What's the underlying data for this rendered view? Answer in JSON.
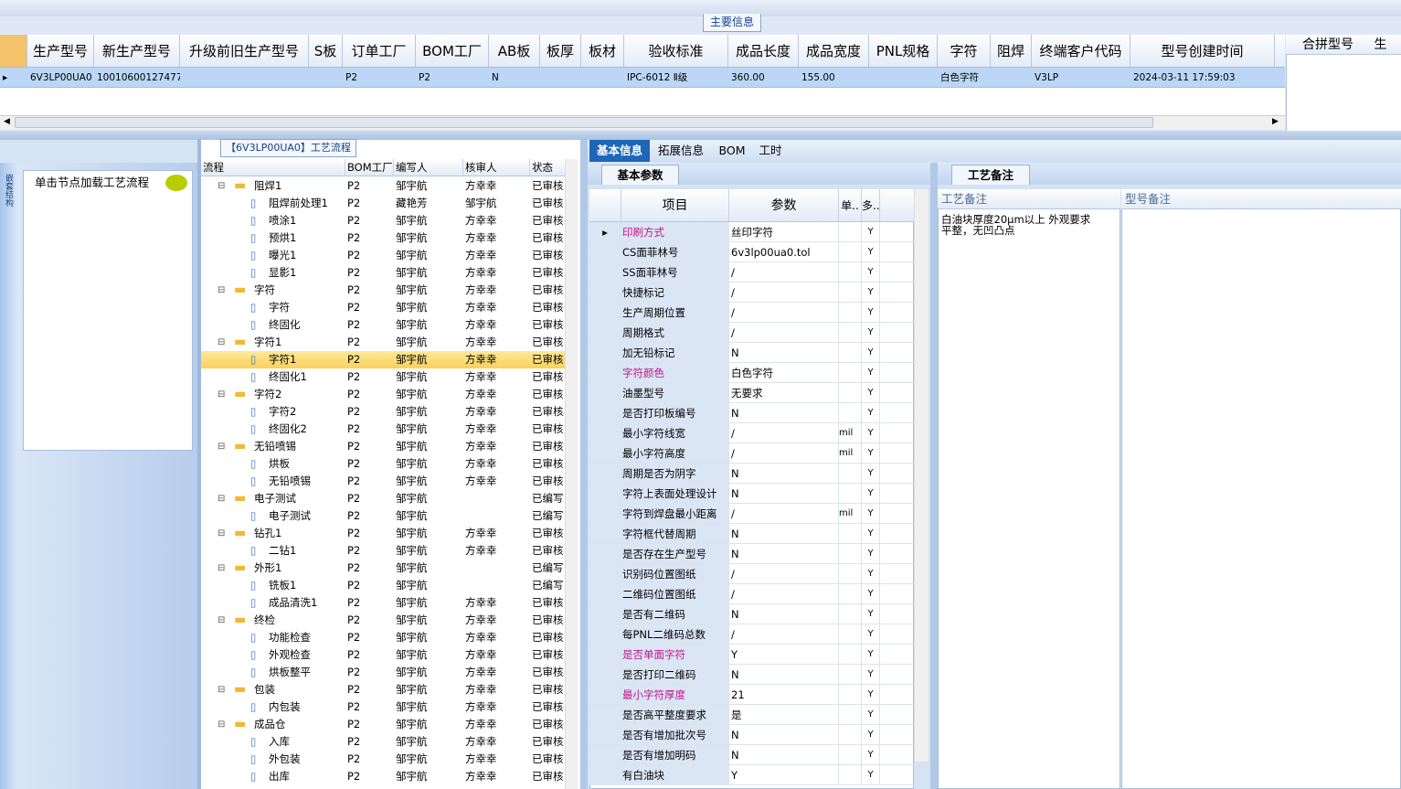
{
  "top": {
    "section_title": "主要信息",
    "columns": [
      "生产型号",
      "新生产型号",
      "升级前旧生产型号",
      "S板",
      "订单工厂",
      "BOM工厂",
      "AB板",
      "板厚",
      "板材",
      "验收标准",
      "成品长度",
      "成品宽度",
      "PNL规格",
      "字符",
      "阻焊",
      "终端客户代码",
      "型号创建时间"
    ],
    "row": [
      "6V3LP00UA0",
      "10010600127477",
      "",
      "",
      "P2",
      "P2",
      "N",
      "",
      "",
      "IPC-6012 Ⅱ级",
      "360.00",
      "155.00",
      "",
      "白色字符",
      "",
      "V3LP",
      "2024-03-11 17:59:03"
    ],
    "right_header": "合拼型号",
    "right_header2": "生"
  },
  "left_nav": {
    "vertical_tab": "嵌套结构",
    "title": "单击节点加载工艺流程"
  },
  "flow": {
    "title": "【6V3LP00UA0】工艺流程",
    "headers": [
      "流程",
      "BOM工厂",
      "编写人",
      "核审人",
      "状态"
    ],
    "rows": [
      {
        "lvl": 1,
        "name": "阻焊1",
        "bom": "P2",
        "writer": "邹宇航",
        "reviewer": "方幸幸",
        "status": "已审核"
      },
      {
        "lvl": 2,
        "name": "阻焊前处理1",
        "bom": "P2",
        "writer": "藏艳芳",
        "reviewer": "邹宇航",
        "status": "已审核"
      },
      {
        "lvl": 2,
        "name": "喷涂1",
        "bom": "P2",
        "writer": "邹宇航",
        "reviewer": "方幸幸",
        "status": "已审核"
      },
      {
        "lvl": 2,
        "name": "预烘1",
        "bom": "P2",
        "writer": "邹宇航",
        "reviewer": "方幸幸",
        "status": "已审核"
      },
      {
        "lvl": 2,
        "name": "曝光1",
        "bom": "P2",
        "writer": "邹宇航",
        "reviewer": "方幸幸",
        "status": "已审核"
      },
      {
        "lvl": 2,
        "name": "显影1",
        "bom": "P2",
        "writer": "邹宇航",
        "reviewer": "方幸幸",
        "status": "已审核"
      },
      {
        "lvl": 1,
        "name": "字符",
        "bom": "P2",
        "writer": "邹宇航",
        "reviewer": "方幸幸",
        "status": "已审核"
      },
      {
        "lvl": 2,
        "name": "字符",
        "bom": "P2",
        "writer": "邹宇航",
        "reviewer": "方幸幸",
        "status": "已审核"
      },
      {
        "lvl": 2,
        "name": "终固化",
        "bom": "P2",
        "writer": "邹宇航",
        "reviewer": "方幸幸",
        "status": "已审核"
      },
      {
        "lvl": 1,
        "name": "字符1",
        "bom": "P2",
        "writer": "邹宇航",
        "reviewer": "方幸幸",
        "status": "已审核"
      },
      {
        "lvl": 2,
        "name": "字符1",
        "bom": "P2",
        "writer": "邹宇航",
        "reviewer": "方幸幸",
        "status": "已审核",
        "selected": true
      },
      {
        "lvl": 2,
        "name": "终固化1",
        "bom": "P2",
        "writer": "邹宇航",
        "reviewer": "方幸幸",
        "status": "已审核"
      },
      {
        "lvl": 1,
        "name": "字符2",
        "bom": "P2",
        "writer": "邹宇航",
        "reviewer": "方幸幸",
        "status": "已审核"
      },
      {
        "lvl": 2,
        "name": "字符2",
        "bom": "P2",
        "writer": "邹宇航",
        "reviewer": "方幸幸",
        "status": "已审核"
      },
      {
        "lvl": 2,
        "name": "终固化2",
        "bom": "P2",
        "writer": "邹宇航",
        "reviewer": "方幸幸",
        "status": "已审核"
      },
      {
        "lvl": 1,
        "name": "无铅喷锡",
        "bom": "P2",
        "writer": "邹宇航",
        "reviewer": "方幸幸",
        "status": "已审核"
      },
      {
        "lvl": 2,
        "name": "烘板",
        "bom": "P2",
        "writer": "邹宇航",
        "reviewer": "方幸幸",
        "status": "已审核"
      },
      {
        "lvl": 2,
        "name": "无铅喷锡",
        "bom": "P2",
        "writer": "邹宇航",
        "reviewer": "方幸幸",
        "status": "已审核"
      },
      {
        "lvl": 1,
        "name": "电子测试",
        "bom": "P2",
        "writer": "邹宇航",
        "reviewer": "",
        "status": "已编写"
      },
      {
        "lvl": 2,
        "name": "电子测试",
        "bom": "P2",
        "writer": "邹宇航",
        "reviewer": "",
        "status": "已编写"
      },
      {
        "lvl": 1,
        "name": "钻孔1",
        "bom": "P2",
        "writer": "邹宇航",
        "reviewer": "方幸幸",
        "status": "已审核"
      },
      {
        "lvl": 2,
        "name": "二钻1",
        "bom": "P2",
        "writer": "邹宇航",
        "reviewer": "方幸幸",
        "status": "已审核"
      },
      {
        "lvl": 1,
        "name": "外形1",
        "bom": "P2",
        "writer": "邹宇航",
        "reviewer": "",
        "status": "已编写"
      },
      {
        "lvl": 2,
        "name": "铣板1",
        "bom": "P2",
        "writer": "邹宇航",
        "reviewer": "",
        "status": "已编写"
      },
      {
        "lvl": 2,
        "name": "成品清洗1",
        "bom": "P2",
        "writer": "邹宇航",
        "reviewer": "方幸幸",
        "status": "已审核"
      },
      {
        "lvl": 1,
        "name": "终检",
        "bom": "P2",
        "writer": "邹宇航",
        "reviewer": "方幸幸",
        "status": "已审核"
      },
      {
        "lvl": 2,
        "name": "功能检查",
        "bom": "P2",
        "writer": "邹宇航",
        "reviewer": "方幸幸",
        "status": "已审核"
      },
      {
        "lvl": 2,
        "name": "外观检查",
        "bom": "P2",
        "writer": "邹宇航",
        "reviewer": "方幸幸",
        "status": "已审核"
      },
      {
        "lvl": 2,
        "name": "烘板整平",
        "bom": "P2",
        "writer": "邹宇航",
        "reviewer": "方幸幸",
        "status": "已审核"
      },
      {
        "lvl": 1,
        "name": "包装",
        "bom": "P2",
        "writer": "邹宇航",
        "reviewer": "方幸幸",
        "status": "已审核"
      },
      {
        "lvl": 2,
        "name": "内包装",
        "bom": "P2",
        "writer": "邹宇航",
        "reviewer": "方幸幸",
        "status": "已审核"
      },
      {
        "lvl": 1,
        "name": "成品仓",
        "bom": "P2",
        "writer": "邹宇航",
        "reviewer": "方幸幸",
        "status": "已审核"
      },
      {
        "lvl": 2,
        "name": "入库",
        "bom": "P2",
        "writer": "邹宇航",
        "reviewer": "方幸幸",
        "status": "已审核"
      },
      {
        "lvl": 2,
        "name": "外包装",
        "bom": "P2",
        "writer": "邹宇航",
        "reviewer": "方幸幸",
        "status": "已审核"
      },
      {
        "lvl": 2,
        "name": "出库",
        "bom": "P2",
        "writer": "邹宇航",
        "reviewer": "方幸幸",
        "status": "已审核"
      }
    ]
  },
  "tabs": [
    "基本信息",
    "拓展信息",
    "BOM",
    "工时"
  ],
  "params": {
    "subtab": "基本参数",
    "headers": [
      "项目",
      "参数",
      "单..",
      "多.."
    ],
    "rows": [
      {
        "item": "印刷方式",
        "val": "丝印字符",
        "unit": "",
        "more": "Y",
        "hl": true
      },
      {
        "item": "CS面菲林号",
        "val": "6v3lp00ua0.tol",
        "unit": "",
        "more": "Y"
      },
      {
        "item": "SS面菲林号",
        "val": "/",
        "unit": "",
        "more": "Y"
      },
      {
        "item": "快捷标记",
        "val": "/",
        "unit": "",
        "more": "Y"
      },
      {
        "item": "生产周期位置",
        "val": "/",
        "unit": "",
        "more": "Y"
      },
      {
        "item": "周期格式",
        "val": "/",
        "unit": "",
        "more": "Y"
      },
      {
        "item": "加无铅标记",
        "val": "N",
        "unit": "",
        "more": "Y"
      },
      {
        "item": "字符颜色",
        "val": "白色字符",
        "unit": "",
        "more": "Y",
        "hl": true
      },
      {
        "item": "油墨型号",
        "val": "无要求",
        "unit": "",
        "more": "Y"
      },
      {
        "item": "是否打印板编号",
        "val": "N",
        "unit": "",
        "more": "Y"
      },
      {
        "item": "最小字符线宽",
        "val": "/",
        "unit": "mil",
        "more": "Y"
      },
      {
        "item": "最小字符高度",
        "val": "/",
        "unit": "mil",
        "more": "Y"
      },
      {
        "item": "周期是否为阴字",
        "val": "N",
        "unit": "",
        "more": "Y"
      },
      {
        "item": "字符上表面处理设计",
        "val": "N",
        "unit": "",
        "more": "Y"
      },
      {
        "item": "字符到焊盘最小距离",
        "val": "/",
        "unit": "mil",
        "more": "Y"
      },
      {
        "item": "字符框代替周期",
        "val": "N",
        "unit": "",
        "more": "Y"
      },
      {
        "item": "是否存在生产型号",
        "val": "N",
        "unit": "",
        "more": "Y"
      },
      {
        "item": "识别码位置图纸",
        "val": "/",
        "unit": "",
        "more": "Y"
      },
      {
        "item": "二维码位置图纸",
        "val": "/",
        "unit": "",
        "more": "Y"
      },
      {
        "item": "是否有二维码",
        "val": "N",
        "unit": "",
        "more": "Y"
      },
      {
        "item": "每PNL二维码总数",
        "val": "/",
        "unit": "",
        "more": "Y"
      },
      {
        "item": "是否单面字符",
        "val": "Y",
        "unit": "",
        "more": "Y",
        "hl": true
      },
      {
        "item": "是否打印二维码",
        "val": "N",
        "unit": "",
        "more": "Y"
      },
      {
        "item": "最小字符厚度",
        "val": "21",
        "unit": "",
        "more": "Y",
        "hl": true
      },
      {
        "item": "是否高平整度要求",
        "val": "是",
        "unit": "",
        "more": "Y"
      },
      {
        "item": "是否有增加批次号",
        "val": "N",
        "unit": "",
        "more": "Y"
      },
      {
        "item": "是否有增加明码",
        "val": "N",
        "unit": "",
        "more": "Y"
      },
      {
        "item": "有白油块",
        "val": "Y",
        "unit": "",
        "more": "Y"
      }
    ]
  },
  "process_notes": {
    "subtab": "工艺备注",
    "col1": "工艺备注",
    "col2": "型号备注",
    "note": "白油块厚度20μm以上 外观要求平整，无凹凸点"
  },
  "colors": {
    "accent": "#1d66b8",
    "highlight_text": "#c0148c",
    "selection": "#bcd7f5"
  }
}
